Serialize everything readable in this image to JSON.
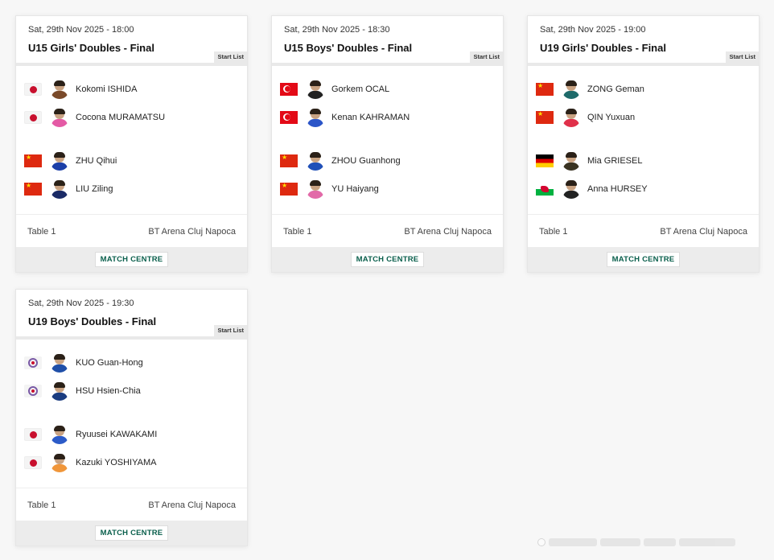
{
  "cards": [
    {
      "datetime": "Sat, 29th Nov 2025 - 18:00",
      "title": "U15 Girls' Doubles - Final",
      "start_list_label": "Start List",
      "team_a": [
        {
          "name": "Kokomi ISHIDA",
          "flag": "japan-flag",
          "shirt": "#7a4a2a"
        },
        {
          "name": "Cocona MURAMATSU",
          "flag": "japan-flag",
          "shirt": "#e45aa5"
        }
      ],
      "team_b": [
        {
          "name": "ZHU Qihui",
          "flag": "china-flag",
          "shirt": "#1c3fa8"
        },
        {
          "name": "LIU Ziling",
          "flag": "china-flag",
          "shirt": "#1a2a66"
        }
      ],
      "table": "Table 1",
      "venue": "BT Arena Cluj Napoca",
      "match_centre_label": "MATCH CENTRE"
    },
    {
      "datetime": "Sat, 29th Nov 2025 - 18:30",
      "title": "U15 Boys' Doubles - Final",
      "start_list_label": "Start List",
      "team_a": [
        {
          "name": "Gorkem OCAL",
          "flag": "turkey-flag",
          "shirt": "#222222"
        },
        {
          "name": "Kenan KAHRAMAN",
          "flag": "turkey-flag",
          "shirt": "#2b55c8"
        }
      ],
      "team_b": [
        {
          "name": "ZHOU Guanhong",
          "flag": "china-flag",
          "shirt": "#2050b8"
        },
        {
          "name": "YU Haiyang",
          "flag": "china-flag",
          "shirt": "#e26aa8"
        }
      ],
      "table": "Table 1",
      "venue": "BT Arena Cluj Napoca",
      "match_centre_label": "MATCH CENTRE"
    },
    {
      "datetime": "Sat, 29th Nov 2025 - 19:00",
      "title": "U19 Girls' Doubles - Final",
      "start_list_label": "Start List",
      "team_a": [
        {
          "name": "ZONG Geman",
          "flag": "china-flag",
          "shirt": "#1e6a6a"
        },
        {
          "name": "QIN Yuxuan",
          "flag": "china-flag",
          "shirt": "#e0304a"
        }
      ],
      "team_b": [
        {
          "name": "Mia GRIESEL",
          "flag": "germany-flag",
          "shirt": "#3a3322"
        },
        {
          "name": "Anna HURSEY",
          "flag": "wales-flag",
          "shirt": "#222222"
        }
      ],
      "table": "Table 1",
      "venue": "BT Arena Cluj Napoca",
      "match_centre_label": "MATCH CENTRE"
    },
    {
      "datetime": "Sat, 29th Nov 2025 - 19:30",
      "title": "U19 Boys' Doubles - Final",
      "start_list_label": "Start List",
      "team_a": [
        {
          "name": "KUO Guan-Hong",
          "flag": "chinese-taipei-flag",
          "shirt": "#1f4fa8"
        },
        {
          "name": "HSU Hsien-Chia",
          "flag": "chinese-taipei-flag",
          "shirt": "#1b3c80"
        }
      ],
      "team_b": [
        {
          "name": "Ryuusei KAWAKAMI",
          "flag": "japan-flag",
          "shirt": "#2c5bc8"
        },
        {
          "name": "Kazuki YOSHIYAMA",
          "flag": "japan-flag",
          "shirt": "#f0963a"
        }
      ],
      "table": "Table 1",
      "venue": "BT Arena Cluj Napoca",
      "match_centre_label": "MATCH CENTRE"
    }
  ],
  "colors": {
    "match_centre_text": "#0a5f4c",
    "footer_bg": "#ececec",
    "page_bg": "#f7f7f7"
  }
}
